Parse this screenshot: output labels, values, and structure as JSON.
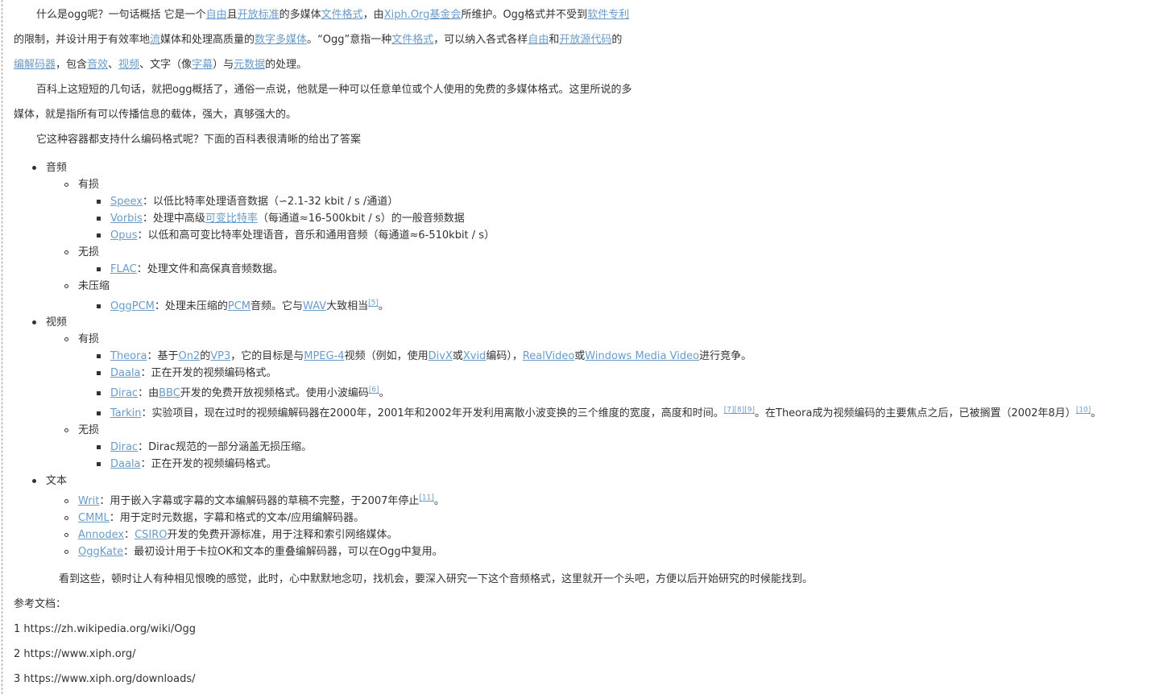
{
  "intro": {
    "l1": {
      "t1": "什么是ogg呢？一句话概括 它是一个",
      "a1": "自由",
      "t2": "且",
      "a2": "开放标准",
      "t3": "的多媒体",
      "a3": "文件格式",
      "t4": "，由",
      "a4": "Xiph.Org基金会",
      "t5": "所维护。Ogg格式并不受到",
      "a5": "软件专利"
    },
    "l2": {
      "t1": "的限制，并设计用于有效率地",
      "a1": "流",
      "t2": "媒体和处理高质量的",
      "a2": "数字多媒体",
      "t3": "。“Ogg”意指一种",
      "a3": "文件格式",
      "t4": "，可以纳入各式各样",
      "a4": "自由",
      "t5": "和",
      "a5": "开放源代码",
      "t6": "的"
    },
    "l3": {
      "a1": "编解码器",
      "t1": "，包含",
      "a2": "音效",
      "t2": "、",
      "a3": "视频",
      "t3": "、文字（像",
      "a4": "字幕",
      "t4": "）与",
      "a5": "元数据",
      "t5": "的处理。"
    },
    "l4": "百科上这短短的几句话，就把ogg概括了，通俗一点说，他就是一种可以任意单位或个人使用的免费的多媒体格式。这里所说的多",
    "l5": "媒体，就是指所有可以传播信息的载体，强大，真够强大的。",
    "l6": "它这种容器都支持什么编码格式呢？下面的百科表很清晰的给出了答案"
  },
  "audio": {
    "label": "音频",
    "lossy": {
      "label": "有损",
      "speex": {
        "name": "Speex",
        "desc": "：以低比特率处理语音数据（∽2.1-32 kbit / s /通道）"
      },
      "vorbis": {
        "name": "Vorbis",
        "d1": "：处理中高级",
        "link": "可变比特率",
        "d2": "（每通道≈16-500kbit / s）的一般音频数据"
      },
      "opus": {
        "name": "Opus",
        "desc": "：以低和高可变比特率处理语音，音乐和通用音频（每通道≈6-510kbit / s）"
      }
    },
    "lossless": {
      "label": "无损",
      "flac": {
        "name": "FLAC",
        "desc": "：处理文件和高保真音频数据。"
      }
    },
    "uncompressed": {
      "label": "未压缩",
      "oggpcm": {
        "name": "OggPCM",
        "d1": "：处理未压缩的",
        "pcm": "PCM",
        "d2": "音频。它与",
        "wav": "WAV",
        "d3": "大致相当",
        "ref": "[5]",
        "d4": "。"
      }
    }
  },
  "video": {
    "label": "视频",
    "lossy": {
      "label": "有损",
      "theora": {
        "name": "Theora",
        "d1": "：基于",
        "on2": "On2",
        "d2": "的",
        "vp3": "VP3",
        "d3": "，它的目标是与",
        "mpeg4": "MPEG-4",
        "d4": "视频（例如，使用",
        "divx": "DivX",
        "d5": "或",
        "xvid": "Xvid",
        "d6": "编码），",
        "realvideo": "RealVideo",
        "d7": "或",
        "wmv": "Windows Media Video",
        "d8": "进行竞争。"
      },
      "daala": {
        "name": "Daala",
        "desc": "：正在开发的视频编码格式。"
      },
      "dirac": {
        "name": "Dirac",
        "d1": "：由",
        "bbc": "BBC",
        "d2": "开发的免费开放视频格式。使用小波编码",
        "ref": "[6]",
        "d3": "。"
      },
      "tarkin": {
        "name": "Tarkin",
        "d1": "：实验项目，现在过时的视频编解码器在2000年，2001年和2002年开发利用离散小波变换的三个维度的宽度，高度和时间。",
        "r1": "[7]",
        "r2": "[8]",
        "r3": "[9]",
        "d2": "。在Theora成为视频编码的主要焦点之后，已被搁置（2002年8月）",
        "r4": "[10]",
        "d3": "。"
      }
    },
    "lossless": {
      "label": "无损",
      "dirac": {
        "name": "Dirac",
        "desc": "：Dirac规范的一部分涵盖无损压缩。"
      },
      "daala": {
        "name": "Daala",
        "desc": "：正在开发的视频编码格式。"
      }
    }
  },
  "text": {
    "label": "文本",
    "writ": {
      "name": "Writ",
      "d1": "：用于嵌入字幕或字幕的文本编解码器的草稿不完整，于2007年停止",
      "ref": "[11]",
      "d2": "。"
    },
    "cmml": {
      "name": "CMML",
      "desc": "：用于定时元数据，字幕和格式的文本/应用编解码器。"
    },
    "annodex": {
      "name": "Annodex",
      "d1": "：",
      "csiro": "CSIRO",
      "d2": "开发的免费开源标准，用于注释和索引网络媒体。"
    },
    "oggkate": {
      "name": "OggKate",
      "desc": "：最初设计用于卡拉OK和文本的重叠编解码器，可以在Ogg中复用。"
    }
  },
  "closing": "看到这些，顿时让人有种相见恨晚的感觉，此时，心中默默地念叨，找机会，要深入研究一下这个音频格式，这里就开一个头吧，方便以后开始研究的时候能找到。",
  "refs": {
    "title": "参考文档：",
    "r1": "1 https://zh.wikipedia.org/wiki/Ogg",
    "r2": "2 https://www.xiph.org/",
    "r3": "3 https://www.xiph.org/downloads/"
  }
}
